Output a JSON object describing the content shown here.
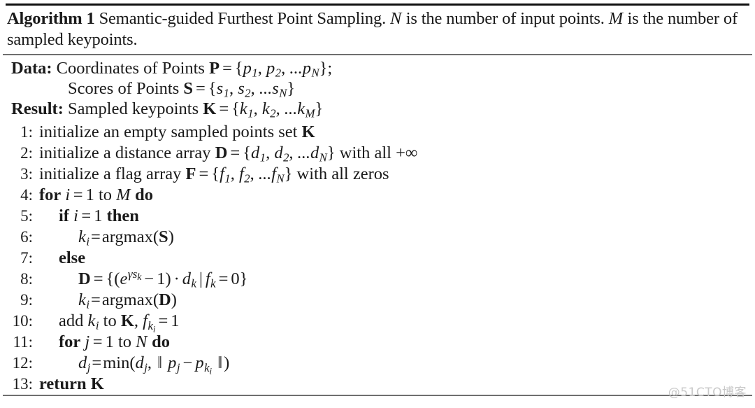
{
  "algorithm": {
    "label": "Algorithm 1",
    "title_text": " Semantic-guided Furthest Point Sampling. ",
    "title_var_n": "N",
    "title_mid": " is the number of input points. ",
    "title_var_m": "M",
    "title_end": " is the number of sampled keypoints.",
    "io": {
      "data_key": "Data:",
      "data_text": " Coordinates of Points ",
      "data_set": "P",
      "data_eq": "=",
      "data_elems": [
        "p",
        "p",
        "...p"
      ],
      "data_subs": [
        "1",
        "2",
        "N"
      ],
      "data_semicolon": ";",
      "scores_text": "Scores of Points ",
      "scores_set": "S",
      "scores_elems": [
        "s",
        "s",
        "...s"
      ],
      "scores_subs": [
        "1",
        "2",
        "N"
      ],
      "result_key": "Result:",
      "result_text": " Sampled keypoints ",
      "result_set": "K",
      "result_elems": [
        "k",
        "k",
        "...k"
      ],
      "result_subs": [
        "1",
        "2",
        "M"
      ]
    },
    "steps": [
      {
        "num": "1:",
        "indent": 0,
        "kind": "text",
        "text_a": "initialize an empty sampled points set ",
        "sym_a": "K"
      },
      {
        "num": "2:",
        "indent": 0,
        "kind": "array-init",
        "text_a": "initialize a distance array ",
        "sym_a": "D",
        "eq": "=",
        "elems": [
          "d",
          "d",
          "...d"
        ],
        "subs": [
          "1",
          "2",
          "N"
        ],
        "text_b": " with all ",
        "tail": "+∞"
      },
      {
        "num": "3:",
        "indent": 0,
        "kind": "array-init",
        "text_a": "initialize a flag array ",
        "sym_a": "F",
        "eq": "=",
        "elems": [
          "f",
          "f",
          "...f"
        ],
        "subs": [
          "1",
          "2",
          "N"
        ],
        "text_b": " with all zeros",
        "tail": ""
      },
      {
        "num": "4:",
        "indent": 0,
        "kind": "for",
        "kw_for": "for",
        "var": "i",
        "eq": "=",
        "start": "1",
        "kw_to": "to",
        "end_var": "M",
        "kw_do": "do"
      },
      {
        "num": "5:",
        "indent": 1,
        "kind": "if",
        "kw_if": "if",
        "var": "i",
        "eq": "=",
        "val": "1",
        "kw_then": "then"
      },
      {
        "num": "6:",
        "indent": 2,
        "kind": "assign-argmax",
        "lhs_var": "k",
        "lhs_sub": "i",
        "eq": "=",
        "fn": "argmax",
        "arg": "S"
      },
      {
        "num": "7:",
        "indent": 1,
        "kind": "else",
        "kw_else": "else"
      },
      {
        "num": "8:",
        "indent": 2,
        "kind": "dist-update",
        "lhs": "D",
        "eq": "=",
        "exp_base": "e",
        "exp_gamma": "γ",
        "exp_s": "s",
        "exp_sub": "k",
        "minus": "−",
        "one": "1",
        "dot": "·",
        "d_var": "d",
        "d_sub": "k",
        "mid": "|",
        "f_var": "f",
        "f_sub": "k",
        "eq2": "=",
        "zero": "0"
      },
      {
        "num": "9:",
        "indent": 2,
        "kind": "assign-argmax",
        "lhs_var": "k",
        "lhs_sub": "i",
        "eq": "=",
        "fn": "argmax",
        "arg": "D"
      },
      {
        "num": "10:",
        "indent": 1,
        "kind": "add",
        "text_a": "add ",
        "k_var": "k",
        "k_sub": "i",
        "text_b": " to ",
        "set": "K",
        "comma": ", ",
        "f_var": "f",
        "f_sub": "k",
        "f_subsub": "i",
        "eq": "=",
        "one": "1"
      },
      {
        "num": "11:",
        "indent": 1,
        "kind": "for",
        "kw_for": "for",
        "var": "j",
        "eq": "=",
        "start": "1",
        "kw_to": "to",
        "end_var": "N",
        "kw_do": "do"
      },
      {
        "num": "12:",
        "indent": 2,
        "kind": "min-update",
        "lhs_var": "d",
        "lhs_sub": "j",
        "eq": "=",
        "fn": "min",
        "d_var": "d",
        "d_sub": "j",
        "comma": ",",
        "norm_open": "‖",
        "p_var": "p",
        "p_sub": "j",
        "minus": "−",
        "pk_var": "p",
        "pk_sub": "k",
        "pk_subsub": "i",
        "norm_close": "‖"
      },
      {
        "num": "13:",
        "indent": 0,
        "kind": "return",
        "kw_return": "return",
        "sym": "K"
      }
    ]
  },
  "watermark": {
    "text": "@51CTO博客"
  }
}
